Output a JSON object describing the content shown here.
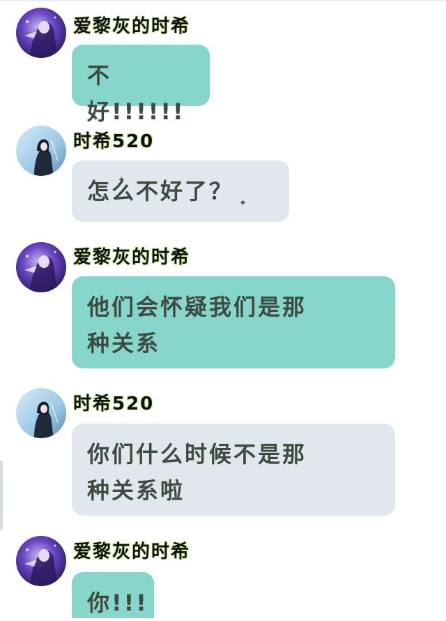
{
  "messages": [
    {
      "sender": "爱黎灰的时希",
      "text": "不好!!!!!!",
      "side": "teal"
    },
    {
      "sender": "时希520",
      "text": "怎么不好了？",
      "side": "grey"
    },
    {
      "sender": "爱黎灰的时希",
      "lines": [
        "他们会怀疑我们是那",
        "种关系"
      ],
      "side": "teal"
    },
    {
      "sender": "时希520",
      "lines": [
        "你们什么时候不是那",
        "种关系啦"
      ],
      "side": "grey"
    },
    {
      "sender": "爱黎灰的时希",
      "text": "你!!!",
      "side": "teal"
    }
  ],
  "colors": {
    "teal_bubble": "#86d6cb",
    "grey_bubble": "#e2e7ee",
    "bubble_text": "#3c4a40",
    "name_glow": "#d8f2a8"
  },
  "icons": {
    "avatar_a": "anime-character-avatar-purple",
    "avatar_b": "anime-character-avatar-blue",
    "sparkle": "sparkle-icon"
  }
}
